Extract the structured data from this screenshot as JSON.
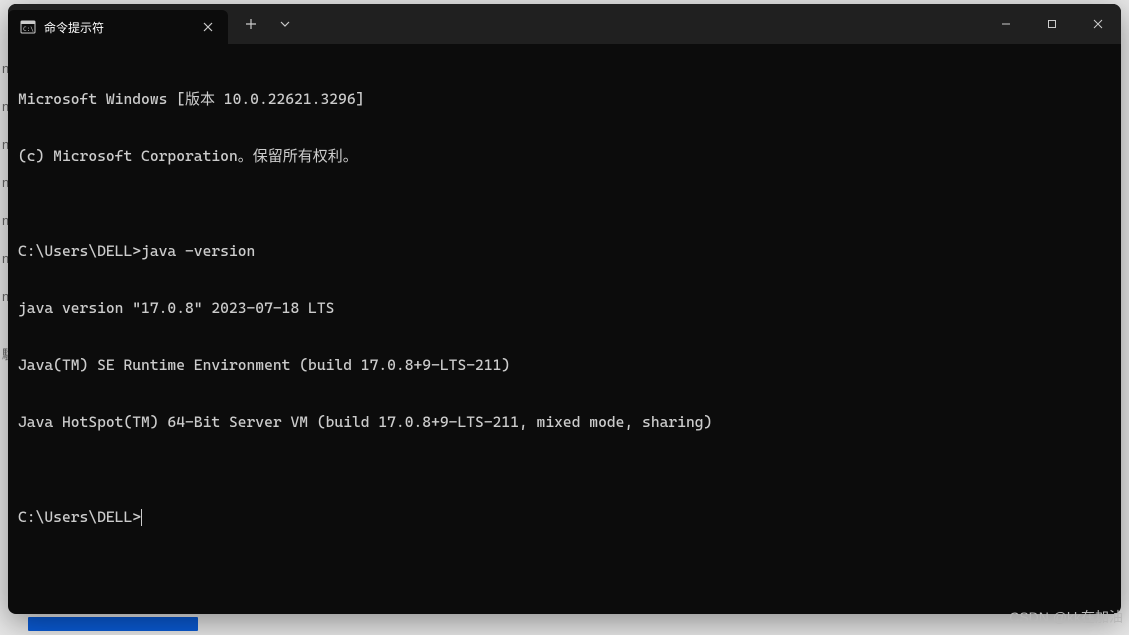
{
  "background": {
    "partial_chars": [
      "n",
      "n",
      "n",
      "n",
      "n",
      "n",
      "n",
      "驗"
    ]
  },
  "window": {
    "tab": {
      "title": "命令提示符"
    }
  },
  "terminal": {
    "lines": [
      "Microsoft Windows [版本 10.0.22621.3296]",
      "(c) Microsoft Corporation。保留所有权利。",
      "",
      "C:\\Users\\DELL>java -version",
      "java version \"17.0.8\" 2023-07-18 LTS",
      "Java(TM) SE Runtime Environment (build 17.0.8+9-LTS-211)",
      "Java HotSpot(TM) 64-Bit Server VM (build 17.0.8+9-LTS-211, mixed mode, sharing)",
      ""
    ],
    "prompt": "C:\\Users\\DELL>"
  },
  "watermark": "CSDN @kk在加油"
}
